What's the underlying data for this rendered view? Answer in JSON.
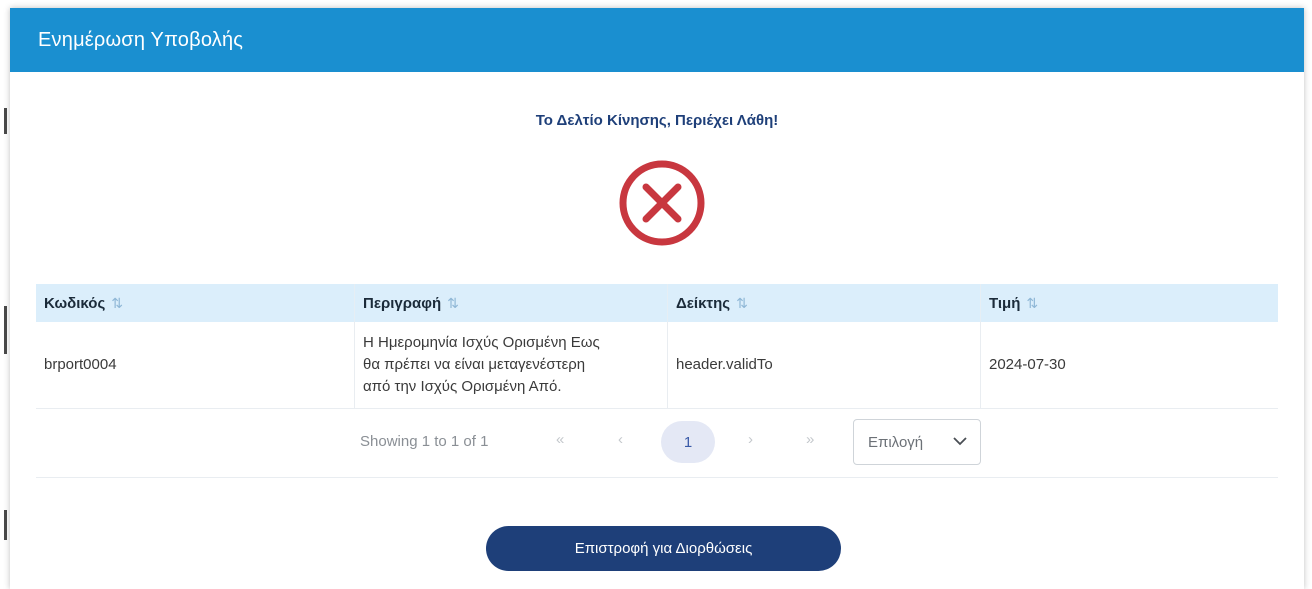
{
  "dialog": {
    "title": "Ενημέρωση Υποβολής",
    "status_message": "Το Δελτίο Κίνησης, Περιέχει Λάθη!",
    "status_icon": "error-circle-x-icon",
    "accent_color": "#1a8fd0",
    "error_color": "#c8373f"
  },
  "table": {
    "columns": [
      {
        "label": "Κωδικός",
        "sort_icon": "⇅"
      },
      {
        "label": "Περιγραφή",
        "sort_icon": "⇅"
      },
      {
        "label": "Δείκτης",
        "sort_icon": "⇅"
      },
      {
        "label": "Τιμή",
        "sort_icon": "⇅"
      }
    ],
    "rows": [
      {
        "code": "brport0004",
        "description_lines": [
          "Η Ημερομηνία Ισχύς Ορισμένη Εως",
          "θα πρέπει να είναι μεταγενέστερη",
          "από την Ισχύς Ορισμένη Από."
        ],
        "indicator": "header.validTo",
        "value": "2024-07-30"
      }
    ]
  },
  "pagination": {
    "summary": "Showing 1 to 1 of 1",
    "first_label": "«",
    "prev_label": "‹",
    "current_page": "1",
    "next_label": "›",
    "last_label": "»",
    "rows_per_page_placeholder": "Επιλογή"
  },
  "actions": {
    "return_label": "Επιστροφή για Διορθώσεις",
    "button_color": "#1e3f79"
  }
}
